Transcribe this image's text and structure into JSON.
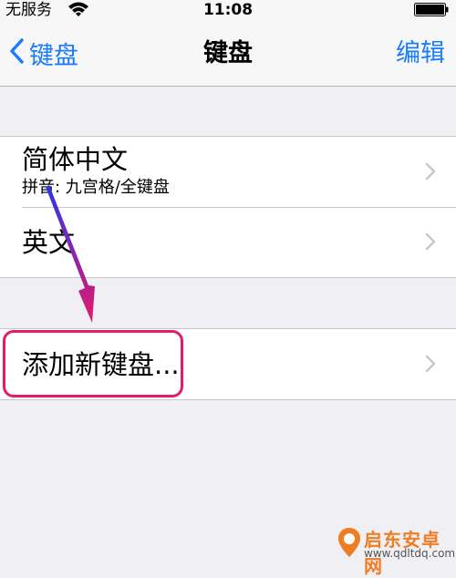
{
  "status_bar": {
    "carrier": "无服务",
    "time": "11:08"
  },
  "nav": {
    "back_label": "键盘",
    "title": "键盘",
    "edit_label": "编辑"
  },
  "keyboards": [
    {
      "title": "简体中文",
      "subtitle": "拼音: 九宫格/全键盘"
    },
    {
      "title": "英文"
    }
  ],
  "add_keyboard": {
    "label": "添加新键盘..."
  },
  "watermark": {
    "name": "启东安卓网",
    "url": "www.qdltdq.com"
  },
  "colors": {
    "accent": "#1a7cff",
    "highlight": "#e6196b",
    "background": "#efeff4"
  }
}
